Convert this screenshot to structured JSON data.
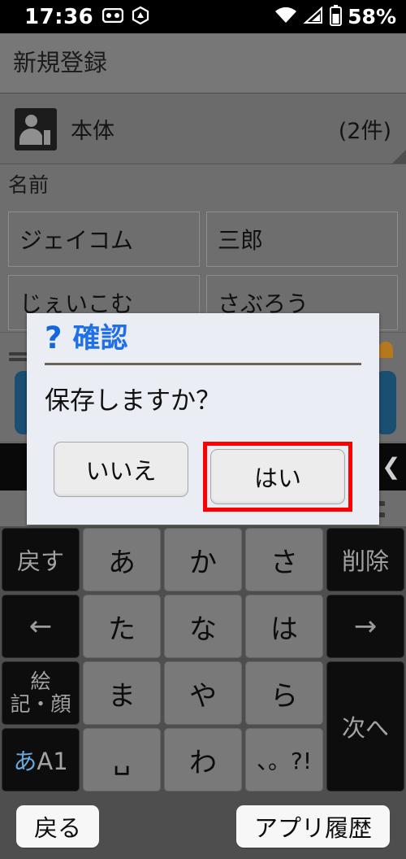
{
  "status_bar": {
    "time": "17:36",
    "left_icons": [
      "voicemail-icon",
      "alert-triangle-icon"
    ],
    "right_icons": [
      "wifi-icon",
      "signal-icon",
      "battery-icon"
    ],
    "battery_percent": "58%"
  },
  "app": {
    "title": "新規登録"
  },
  "account": {
    "icon": "contact-device-icon",
    "label": "本体",
    "count": "(2件)"
  },
  "name_section": {
    "label": "名前",
    "fields": [
      {
        "name": "last-name",
        "value": "ジェイコム"
      },
      {
        "name": "first-name",
        "value": "三郎"
      },
      {
        "name": "last-name-kana",
        "value": "じぇいこむ"
      },
      {
        "name": "first-name-kana",
        "value": "さぶろう"
      }
    ]
  },
  "dialog": {
    "icon": "question-mark-icon",
    "title": "確認",
    "message": "保存しますか？",
    "buttons": [
      {
        "name": "no-button",
        "label": "いいえ",
        "highlighted": false
      },
      {
        "name": "yes-button",
        "label": "はい",
        "highlighted": true
      }
    ],
    "highlight_color": "#ff0000",
    "title_color": "#1f6fe8"
  },
  "keyboard": {
    "rows": [
      [
        {
          "label": "戻す",
          "type": "fn"
        },
        {
          "label": "あ",
          "type": "mid"
        },
        {
          "label": "か",
          "type": "mid"
        },
        {
          "label": "さ",
          "type": "mid"
        },
        {
          "label": "削除",
          "type": "fn"
        }
      ],
      [
        {
          "label": "←",
          "type": "fn-arrow"
        },
        {
          "label": "た",
          "type": "mid"
        },
        {
          "label": "な",
          "type": "mid"
        },
        {
          "label": "は",
          "type": "mid"
        },
        {
          "label": "→",
          "type": "fn-arrow"
        }
      ],
      [
        {
          "label": "絵\n記・顔",
          "type": "fn-stack"
        },
        {
          "label": "ま",
          "type": "mid"
        },
        {
          "label": "や",
          "type": "mid"
        },
        {
          "label": "ら",
          "type": "mid"
        },
        {
          "label": "次へ",
          "type": "fn-tall"
        }
      ],
      [
        {
          "label": "あA1",
          "type": "fn-mode"
        },
        {
          "label": "␣",
          "type": "mid-space"
        },
        {
          "label": "わ",
          "type": "mid"
        },
        {
          "label": "、。?!",
          "type": "mid-small"
        }
      ]
    ],
    "key_emoji_line1": "絵",
    "key_emoji_line2": "記・顔",
    "key_mode_blue": "あ",
    "key_mode_rest": "A1"
  },
  "navbar": {
    "back_label": "戻る",
    "recents_label": "アプリ履歴"
  }
}
